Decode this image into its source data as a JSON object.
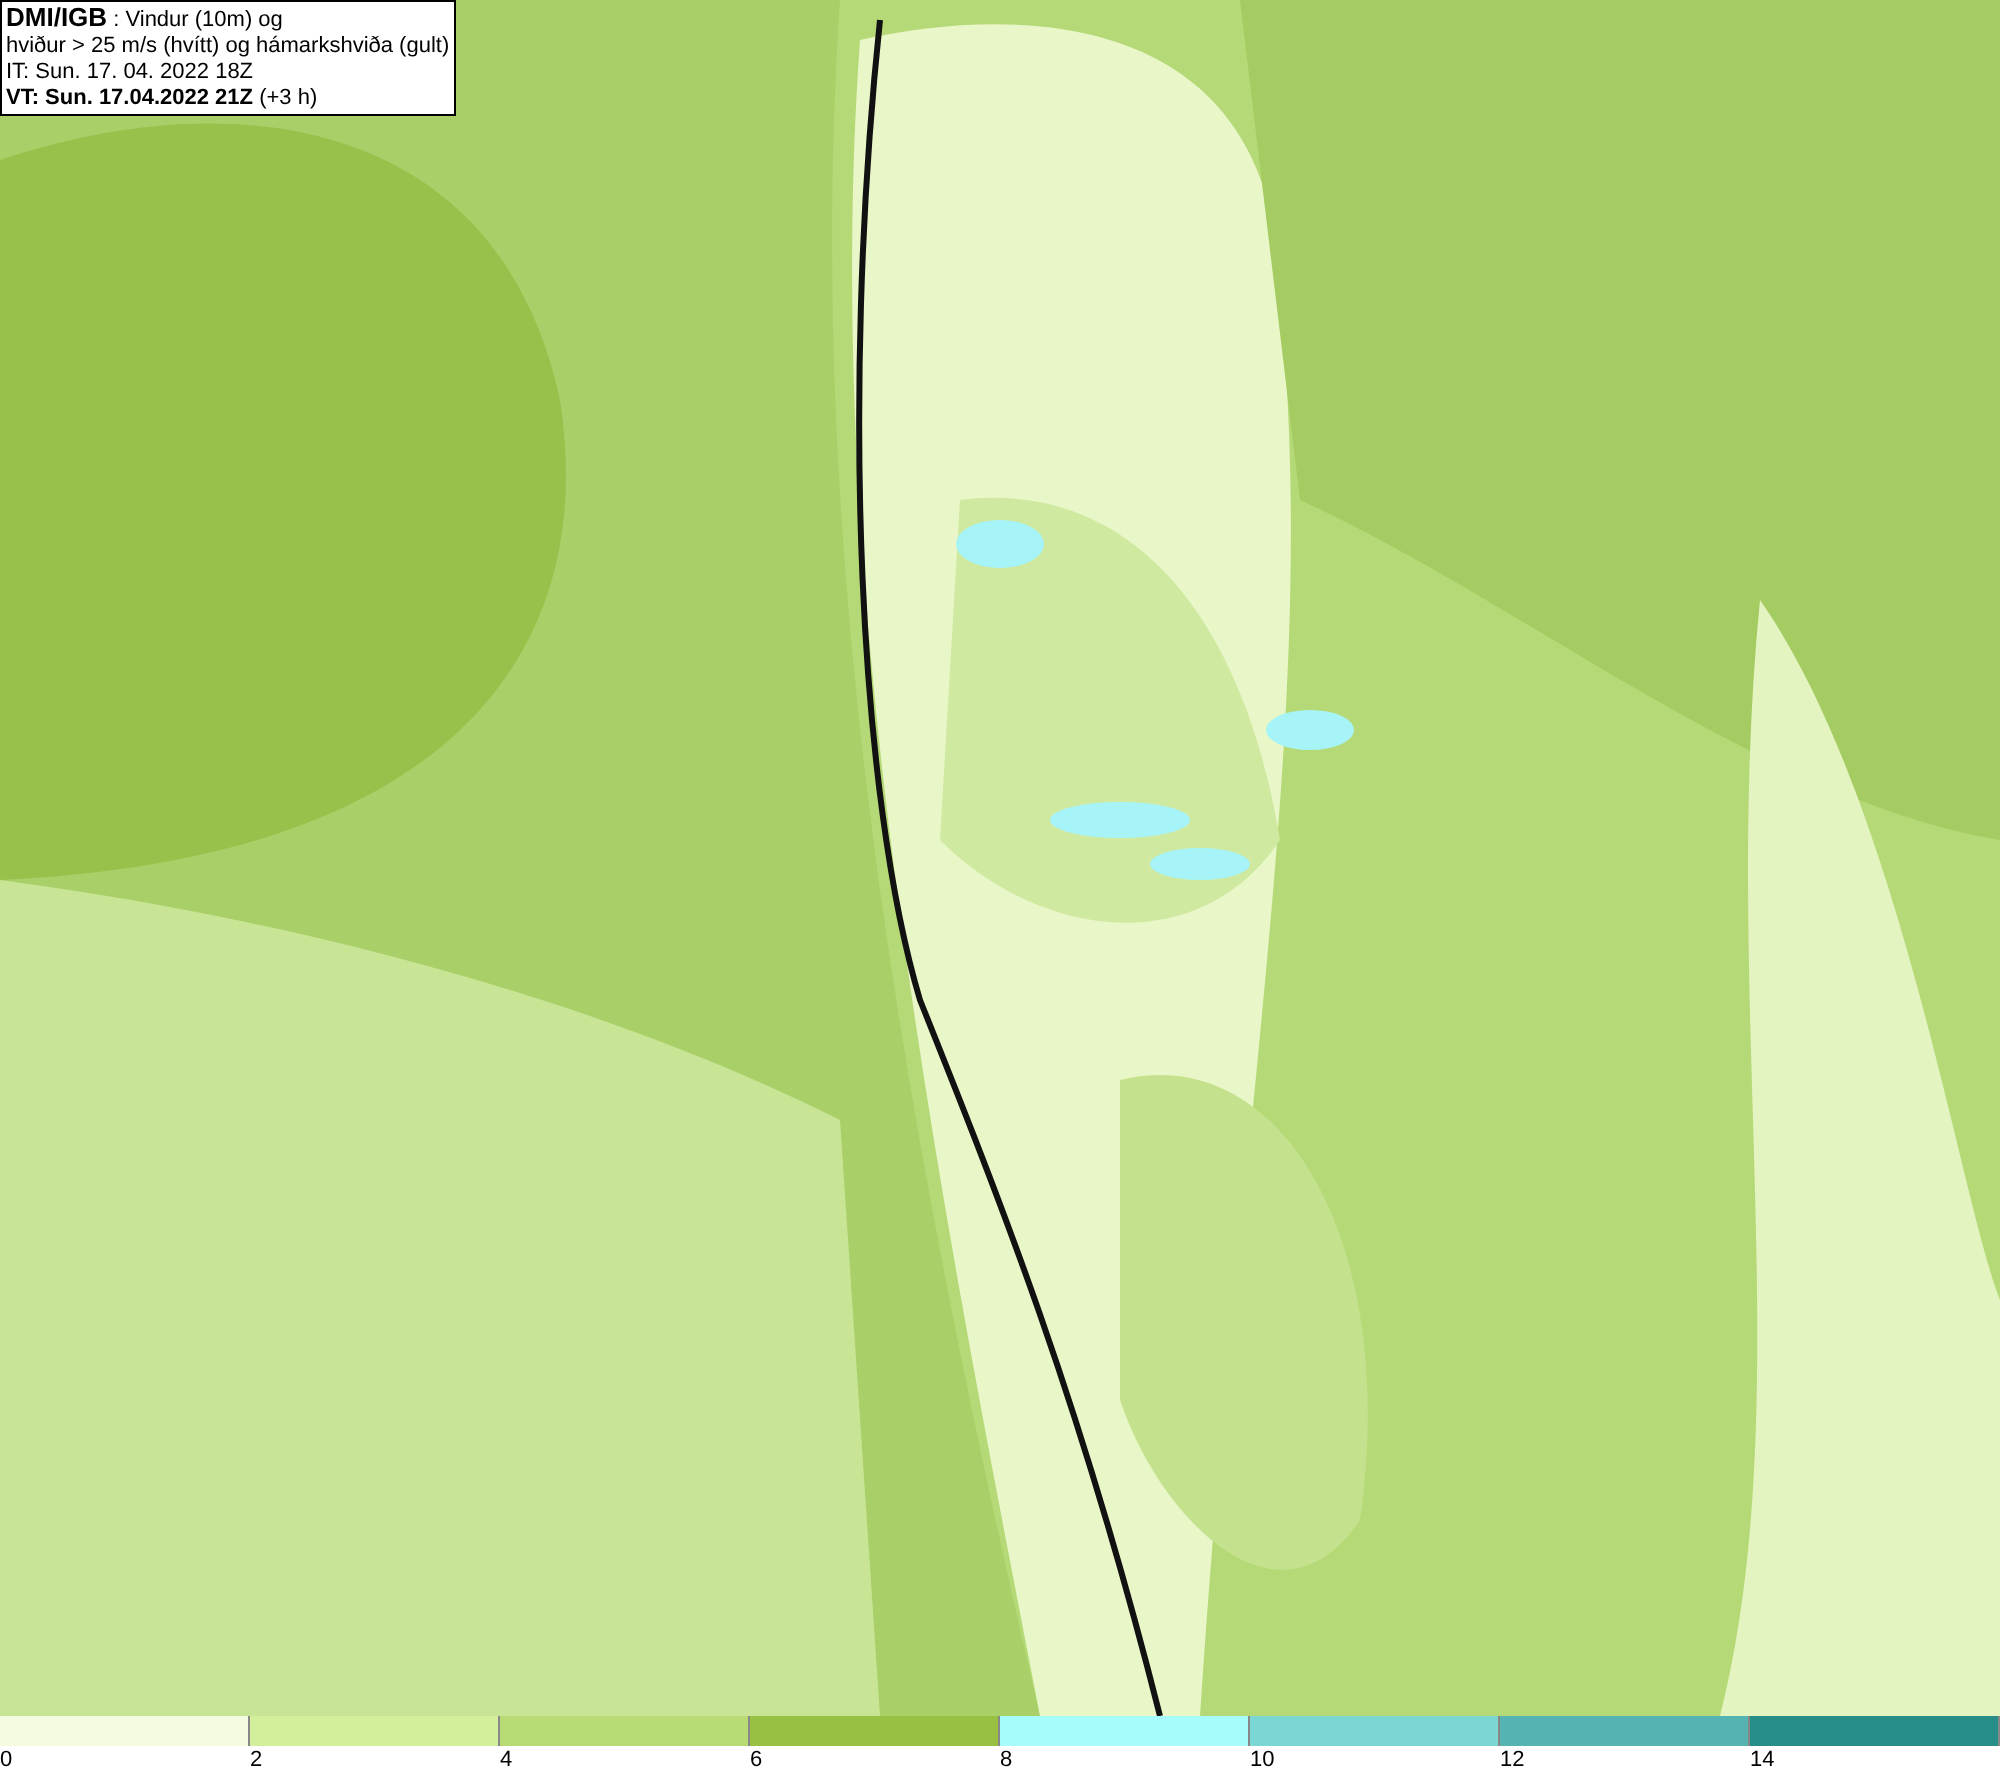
{
  "info_box": {
    "lines": [
      "**DMI/IGB** : Vindur (10m) og",
      "hviður > 25 m/s (hvítt) og hámarkshviða (gult)",
      "IT: Sun. 17. 04. 2022 18Z",
      "**VT: Sun. 17.04.2022 21Z** (+3 h)"
    ]
  },
  "legend": [
    {
      "label": "0",
      "color": "#f3fcde"
    },
    {
      "label": "2",
      "color": "#d3ef9c"
    },
    {
      "label": "4",
      "color": "#b8db74"
    },
    {
      "label": "6",
      "color": "#98c043"
    },
    {
      "label": "8",
      "color": "#a6fcfa"
    },
    {
      "label": "10",
      "color": "#7cd6d3"
    },
    {
      "label": "12",
      "color": "#55b3b2"
    },
    {
      "label": "14",
      "color": "#268d88"
    }
  ]
}
